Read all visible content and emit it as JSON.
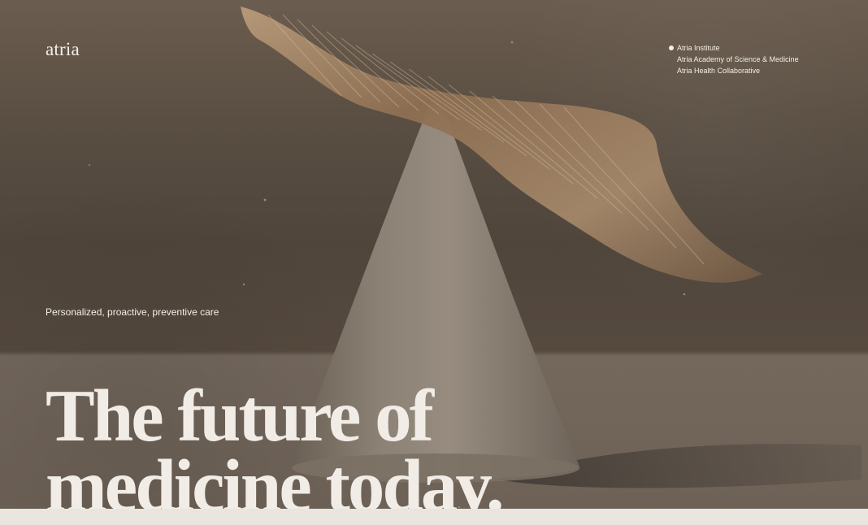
{
  "brand": {
    "logo": "atria"
  },
  "nav": {
    "items": [
      "Atria Institute",
      "Atria Academy of Science & Medicine",
      "Atria Health Collaborative"
    ]
  },
  "hero": {
    "tagline": "Personalized, proactive, preventive care",
    "headline_line_1": "The future of",
    "headline_line_2": "medicine today."
  },
  "colors": {
    "background_dark": "#564a3f",
    "text_light": "#f1ede6",
    "cone": "#8b8072",
    "fabric": "#9b7d5f"
  },
  "icons": {
    "active_nav_marker": "dot-icon"
  }
}
